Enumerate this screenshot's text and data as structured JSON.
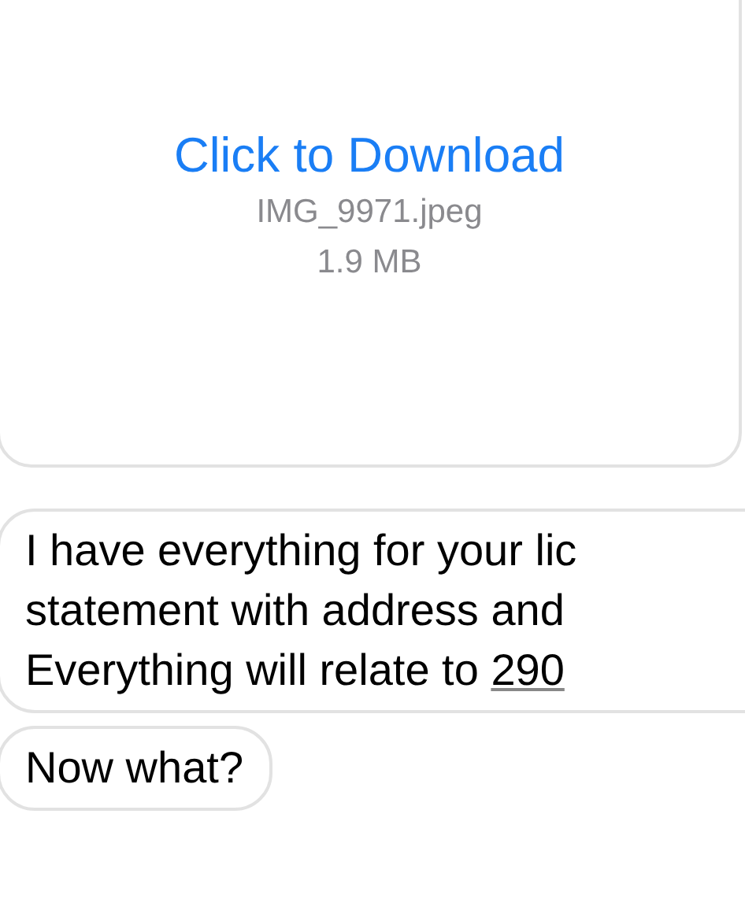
{
  "attachment": {
    "action": "Click to Download",
    "filename": "IMG_9971.jpeg",
    "size": "1.9 MB"
  },
  "messages": [
    {
      "lines": [
        {
          "text": "I have everything for your lic"
        },
        {
          "text": "statement with address and"
        },
        {
          "text": "Everything will relate to ",
          "link": "290"
        }
      ]
    },
    {
      "lines": [
        {
          "text": "Now what?"
        }
      ]
    }
  ]
}
